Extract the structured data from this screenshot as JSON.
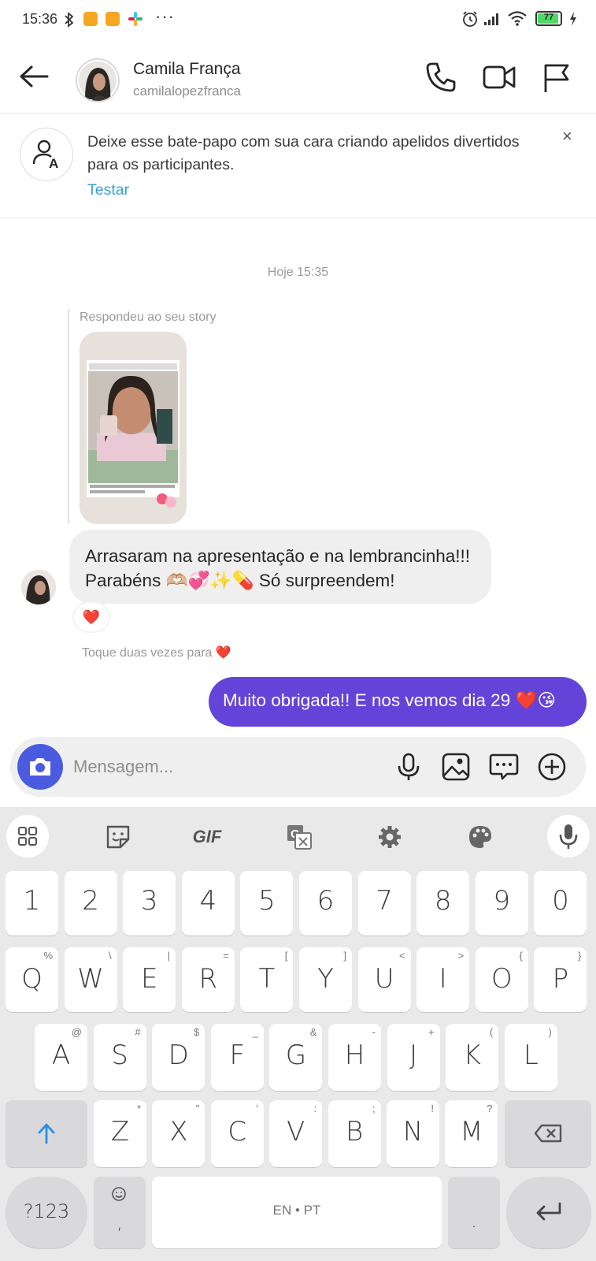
{
  "status_bar": {
    "time": "15:36",
    "battery": "77",
    "more": "···"
  },
  "header": {
    "name": "Camila França",
    "username": "camilalopezfranca",
    "icons": [
      "back-arrow-icon",
      "phone-icon",
      "video-camera-icon",
      "flag-icon"
    ]
  },
  "banner": {
    "text": "Deixe esse bate-papo com sua cara criando apelidos divertidos para os participantes.",
    "link": "Testar",
    "close": "×"
  },
  "chat": {
    "timestamp": "Hoje 15:35",
    "reply_label": "Respondeu ao seu story",
    "incoming_line1": "Arrasaram na apresentação e na lembrancinha!!!",
    "incoming_line2": "Parabéns 🫶🏼💞✨💊 Só surpreendem!",
    "reaction": "❤️",
    "hint": "Toque duas vezes para ❤️",
    "outgoing": "Muito obrigada!! E nos vemos dia 29 ❤️😘"
  },
  "composer": {
    "placeholder": "Mensagem..."
  },
  "keyboard": {
    "toolbar": [
      "apps-grid-icon",
      "sticker-icon",
      "GIF",
      "translate-icon",
      "settings-icon",
      "palette-icon",
      "mic-icon"
    ],
    "gif_label": "GIF",
    "numbers": [
      "1",
      "2",
      "3",
      "4",
      "5",
      "6",
      "7",
      "8",
      "9",
      "0"
    ],
    "row1": [
      [
        "Q",
        "%"
      ],
      [
        "W",
        "\\"
      ],
      [
        "E",
        "|"
      ],
      [
        "R",
        "="
      ],
      [
        "T",
        "["
      ],
      [
        "Y",
        "]"
      ],
      [
        "U",
        "<"
      ],
      [
        "I",
        ">"
      ],
      [
        "O",
        "{"
      ],
      [
        "P",
        "}"
      ]
    ],
    "row2": [
      [
        "A",
        "@"
      ],
      [
        "S",
        "#"
      ],
      [
        "D",
        "$"
      ],
      [
        "F",
        "_"
      ],
      [
        "G",
        "&"
      ],
      [
        "H",
        "-"
      ],
      [
        "J",
        "+"
      ],
      [
        "K",
        "("
      ],
      [
        "L",
        ")"
      ]
    ],
    "row3": [
      [
        "Z",
        "*"
      ],
      [
        "X",
        "\""
      ],
      [
        "C",
        "'"
      ],
      [
        "V",
        ":"
      ],
      [
        "B",
        ";"
      ],
      [
        "N",
        "!"
      ],
      [
        "M",
        "?"
      ]
    ],
    "symbols_key": "?123",
    "comma_key": ",",
    "space_label": "EN • PT",
    "period_key": "."
  },
  "colors": {
    "accent": "#6443d8",
    "camera": "#4a5be0",
    "link": "#3aa0d6"
  }
}
